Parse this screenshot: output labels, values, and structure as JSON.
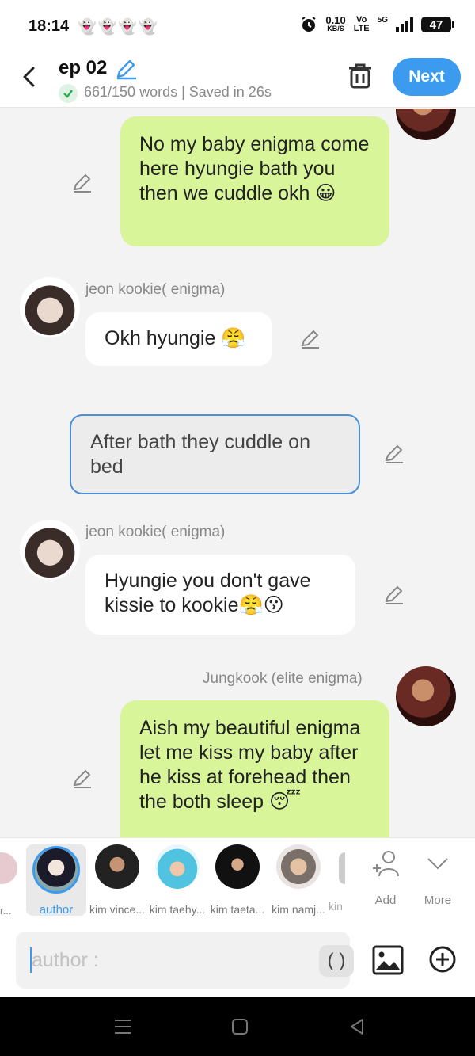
{
  "status_bar": {
    "time": "18:14",
    "notification_icons": "👻👻👻👻",
    "speed_value": "0.10",
    "speed_unit": "KB/S",
    "volte": "Vo",
    "volte_sub": "LTE",
    "network": "5G",
    "battery": "47"
  },
  "header": {
    "title": "ep 02",
    "word_status": "661/150 words | Saved in 26s",
    "next_label": "Next"
  },
  "messages": [
    {
      "speaker": "",
      "text": "No my baby enigma come here hyungie bath you then we cuddle okh 😀"
    },
    {
      "speaker": "jeon kookie( enigma)",
      "text": "Okh hyungie 😤"
    },
    {
      "speaker": "",
      "text": "After bath they cuddle on bed"
    },
    {
      "speaker": "jeon kookie( enigma)",
      "text": "Hyungie you don't gave kissie to kookie😤😗"
    },
    {
      "speaker": "Jungkook (elite enigma)",
      "text": "Aish my beautiful enigma let me kiss my baby after he kiss at forehead then the both sleep 😴"
    }
  ],
  "characters": {
    "partial_left": "r...",
    "items": [
      {
        "label": "author"
      },
      {
        "label": "kim vince..."
      },
      {
        "label": "kim taehy..."
      },
      {
        "label": "kim taeta..."
      },
      {
        "label": "kim namj..."
      },
      {
        "label": "kin"
      }
    ],
    "add_label": "Add",
    "more_label": "More"
  },
  "composer": {
    "placeholder": "author :",
    "paren_label": "( )"
  },
  "colors": {
    "accent": "#3d9bef",
    "green_bubble": "#d8f59a",
    "underline": "#f0a21b"
  }
}
